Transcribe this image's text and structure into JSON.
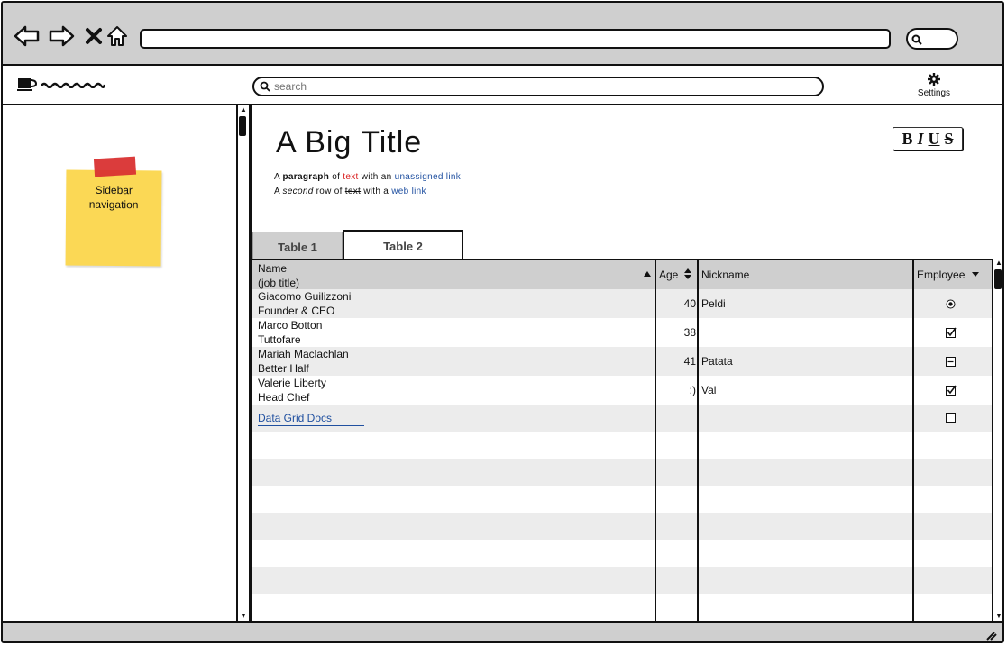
{
  "search": {
    "placeholder": "search"
  },
  "settings": {
    "label": "Settings",
    "icon": "gear-icon"
  },
  "sidebar": {
    "note": [
      "Sidebar",
      "navigation"
    ]
  },
  "content": {
    "title": "A Big Title",
    "paragraph1": {
      "a": "A",
      "bold": "paragraph",
      "of": "of",
      "red": "text",
      "with": "with an",
      "link": "unassigned link"
    },
    "paragraph2": {
      "a": "A",
      "italic": "second",
      "row": "row of",
      "strike": "text",
      "with": "with a",
      "link": "web link"
    },
    "format": {
      "b": "B",
      "i": "I",
      "u": "U",
      "s": "S"
    }
  },
  "tabs": [
    "Table 1",
    "Table 2"
  ],
  "table": {
    "headers": {
      "name": [
        "Name",
        "(job title)"
      ],
      "age": "Age",
      "nickname": "Nickname",
      "employee": "Employee"
    },
    "rows": [
      {
        "name": "Giacomo Guilizzoni",
        "title": "Founder & CEO",
        "age": "40",
        "nickname": "Peldi",
        "employee": "radio-selected"
      },
      {
        "name": "Marco Botton",
        "title": "Tuttofare",
        "age": "38",
        "nickname": "",
        "employee": "checked"
      },
      {
        "name": "Mariah Maclachlan",
        "title": "Better Half",
        "age": "41",
        "nickname": "Patata",
        "employee": "indeterminate"
      },
      {
        "name": "Valerie Liberty",
        "title": "Head Chef",
        "age": ":)",
        "nickname": "Val",
        "employee": "checked"
      }
    ],
    "link": "Data Grid Docs",
    "link_employee": "unchecked"
  },
  "colors": {
    "chrome": "#cfcfcf",
    "row_alt": "#ececec",
    "sticky": "#fbd855",
    "tape": "#d93232",
    "link": "#2050a0",
    "red_text": "#d92020"
  }
}
